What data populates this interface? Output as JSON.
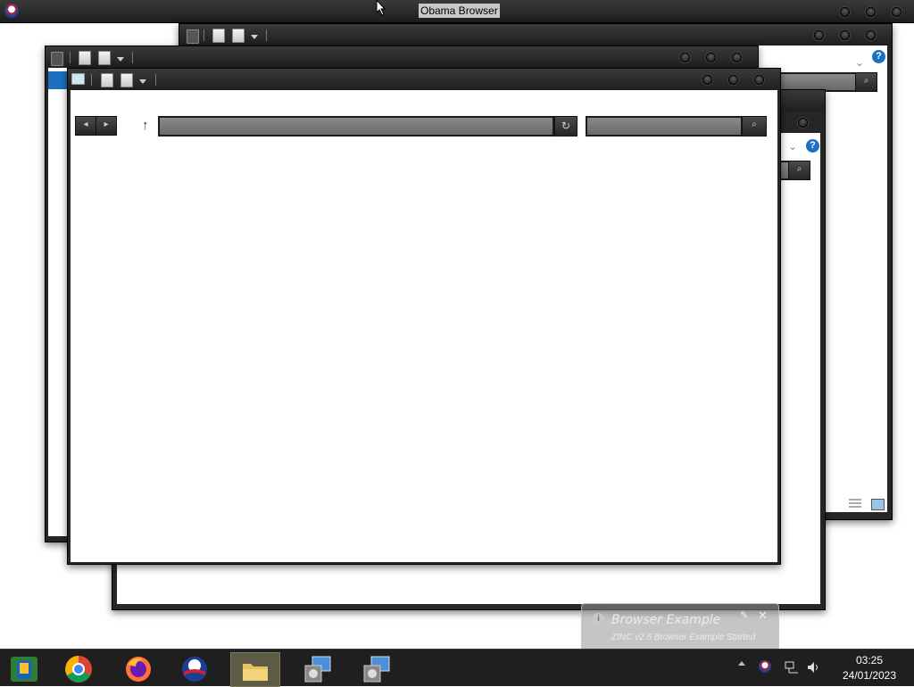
{
  "app": {
    "title": "Obama Browser"
  },
  "address_bar": {
    "url": ""
  },
  "search_bar": {
    "query": ""
  },
  "notification": {
    "title": "Browser Example",
    "message": "ZINC v2.5 Browser Example Started"
  },
  "taskbar": {
    "apps": [
      {
        "name": "mobile-app"
      },
      {
        "name": "chrome"
      },
      {
        "name": "firefox"
      },
      {
        "name": "obama-browser"
      },
      {
        "name": "file-explorer"
      },
      {
        "name": "installer-1"
      },
      {
        "name": "installer-2"
      }
    ]
  },
  "clock": {
    "time": "03:25",
    "date": "24/01/2023"
  }
}
